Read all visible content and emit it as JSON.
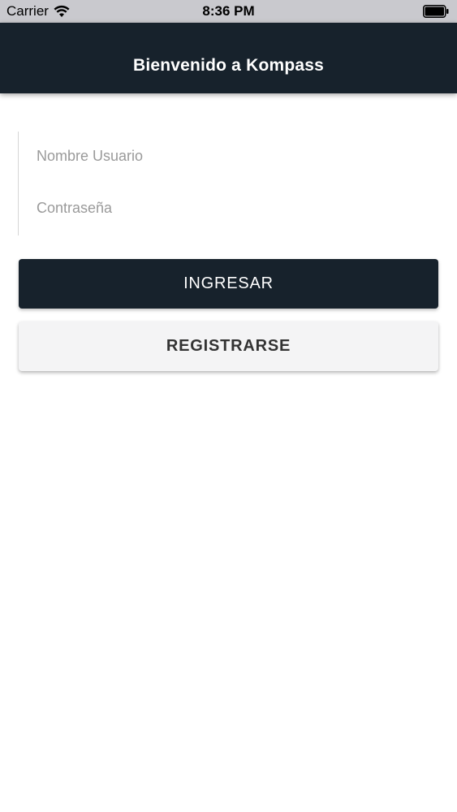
{
  "status_bar": {
    "carrier": "Carrier",
    "time": "8:36 PM",
    "wifi_icon": "wifi-icon",
    "battery_icon": "battery-icon"
  },
  "header": {
    "title": "Bienvenido a Kompass",
    "background": "#17222c"
  },
  "form": {
    "username_placeholder": "Nombre Usuario",
    "username_value": "",
    "password_placeholder": "Contraseña",
    "password_value": ""
  },
  "buttons": {
    "login_label": "INGRESAR",
    "register_label": "REGISTRARSE"
  },
  "colors": {
    "primary": "#17222c",
    "secondary_button": "#f4f4f5",
    "placeholder": "#9a9a9a"
  }
}
